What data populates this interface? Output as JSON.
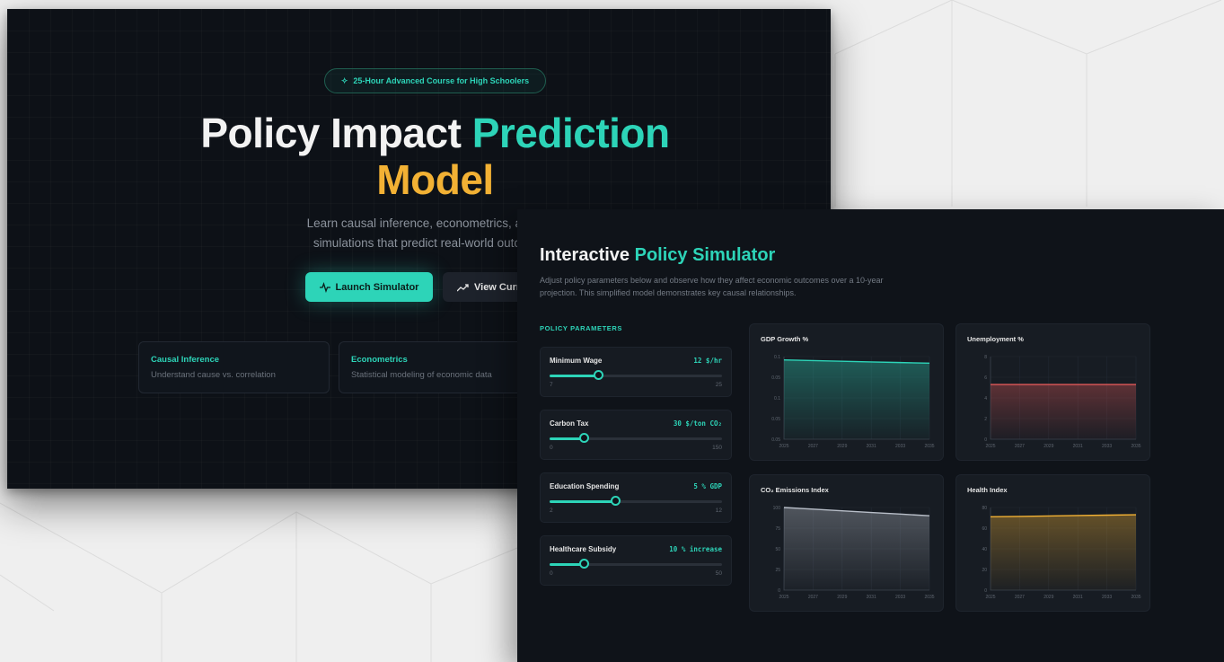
{
  "landing": {
    "badge": "25-Hour Advanced Course for High Schoolers",
    "title_part1": "Policy Impact ",
    "title_part2": "Prediction",
    "title_part3": "Model",
    "subtitle_line1": "Learn causal inference, econometrics, and policy",
    "subtitle_line2": "simulations that predict real-world outcomes of",
    "launch_button": "Launch Simulator",
    "curriculum_button": "View Curr",
    "features": [
      {
        "title": "Causal Inference",
        "desc": "Understand cause vs. correlation"
      },
      {
        "title": "Econometrics",
        "desc": "Statistical modeling of economic data"
      }
    ],
    "colors": {
      "accent": "#2dd4b8",
      "highlight": "#f2b134",
      "background": "#0d1117"
    }
  },
  "simulator": {
    "title_part1": "Interactive ",
    "title_part2": "Policy Simulator",
    "description": "Adjust policy parameters below and observe how they affect economic outcomes over a 10-year projection. This simplified model demonstrates key causal relationships.",
    "params_label": "POLICY PARAMETERS",
    "params": [
      {
        "name": "Minimum Wage",
        "value": "12 $/hr",
        "min": "7",
        "max": "25",
        "fraction": 0.28
      },
      {
        "name": "Carbon Tax",
        "value": "30 $/ton CO₂",
        "min": "0",
        "max": "150",
        "fraction": 0.2
      },
      {
        "name": "Education Spending",
        "value": "5 % GDP",
        "min": "2",
        "max": "12",
        "fraction": 0.38
      },
      {
        "name": "Healthcare Subsidy",
        "value": "10 % increase",
        "min": "0",
        "max": "50",
        "fraction": 0.2
      }
    ]
  },
  "chart_data": [
    {
      "type": "area",
      "title": "GDP Growth %",
      "x": [
        "2025",
        "2027",
        "2029",
        "2031",
        "2033",
        "2035"
      ],
      "values": [
        0.12,
        0.119,
        0.118,
        0.117,
        0.116,
        0.115
      ],
      "yticks": [
        "0.1",
        "0.05",
        "0.1",
        "0.05",
        "0.05"
      ],
      "ylim": [
        0,
        0.125
      ],
      "color": "#2dd4b8"
    },
    {
      "type": "area",
      "title": "Unemployment %",
      "x": [
        "2025",
        "2027",
        "2029",
        "2031",
        "2033",
        "2035"
      ],
      "values": [
        5.3,
        5.3,
        5.3,
        5.3,
        5.3,
        5.3
      ],
      "yticks": [
        "8",
        "6",
        "4",
        "2",
        "0"
      ],
      "ylim": [
        0,
        8
      ],
      "color": "#e05858"
    },
    {
      "type": "area",
      "title": "CO₂ Emissions Index",
      "x": [
        "2025",
        "2027",
        "2029",
        "2031",
        "2033",
        "2035"
      ],
      "values": [
        100,
        98,
        96,
        94,
        92,
        90
      ],
      "yticks": [
        "100",
        "75",
        "50",
        "25",
        "0"
      ],
      "ylim": [
        0,
        100
      ],
      "color": "#b8bec8"
    },
    {
      "type": "area",
      "title": "Health Index",
      "x": [
        "2025",
        "2027",
        "2029",
        "2031",
        "2033",
        "2035"
      ],
      "values": [
        71,
        71.4,
        71.8,
        72.2,
        72.6,
        73
      ],
      "yticks": [
        "80",
        "60",
        "40",
        "20",
        "0"
      ],
      "ylim": [
        0,
        80
      ],
      "color": "#f2b134"
    }
  ]
}
